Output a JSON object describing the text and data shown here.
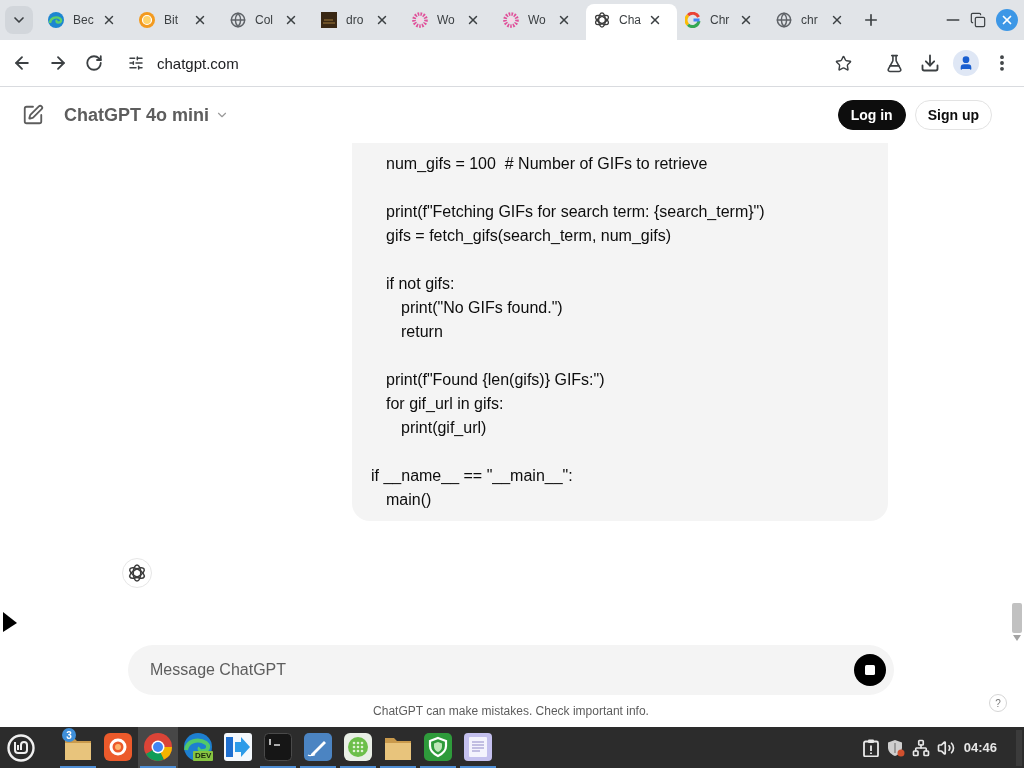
{
  "browser": {
    "tabs": [
      {
        "title": "Bec",
        "kind": "swirl",
        "selected": false
      },
      {
        "title": "Bit",
        "kind": "coin",
        "selected": false
      },
      {
        "title": "Col",
        "kind": "globe",
        "selected": false
      },
      {
        "title": "dro",
        "kind": "thumbnail",
        "selected": false
      },
      {
        "title": "Wo",
        "kind": "flower",
        "selected": false
      },
      {
        "title": "Wo",
        "kind": "flower",
        "selected": false
      },
      {
        "title": "Cha",
        "kind": "knot",
        "selected": true
      },
      {
        "title": "Chr",
        "kind": "g",
        "selected": false
      },
      {
        "title": "chr",
        "kind": "globe",
        "selected": false
      }
    ],
    "url": "chatgpt.com"
  },
  "page": {
    "header": {
      "model": "ChatGPT 4o mini",
      "buttons": [
        {
          "label": "Log in",
          "kind": "filled"
        },
        {
          "label": "Sign up",
          "kind": "outline"
        }
      ]
    },
    "code_blocks": [
      [
        "    num_gifs = 100  # Number of GIFs to retrieve"
      ],
      [
        "    print(f\"Fetching GIFs for search term: {search_term}\")",
        "    gifs = fetch_gifs(search_term, num_gifs)"
      ],
      [
        "    if not gifs:",
        "        print(\"No GIFs found.\")",
        "        return"
      ],
      [
        "    print(f\"Found {len(gifs)} GIFs:\")",
        "    for gif_url in gifs:",
        "        print(gif_url)"
      ],
      [
        "if __name__ == \"__main__\":",
        "    main()"
      ]
    ],
    "composer": {
      "placeholder": "Message ChatGPT"
    },
    "disclaimer": "ChatGPT can make mistakes. Check important info.",
    "help": "?"
  },
  "taskbar": {
    "apps": [
      {
        "kind": "folder",
        "count": "3",
        "running": true,
        "selected": false
      },
      {
        "kind": "fox",
        "running": false,
        "selected": false
      },
      {
        "kind": "chrome",
        "running": true,
        "selected": true
      },
      {
        "kind": "edge",
        "tag": "DEV",
        "running": false,
        "selected": false
      },
      {
        "kind": "arrow",
        "running": false,
        "selected": false
      },
      {
        "kind": "terminal",
        "running": true,
        "selected": false
      },
      {
        "kind": "pen",
        "running": true,
        "selected": false
      },
      {
        "kind": "grid",
        "running": true,
        "selected": false
      },
      {
        "kind": "folder",
        "running": true,
        "selected": false
      },
      {
        "kind": "shield",
        "running": true,
        "selected": false
      },
      {
        "kind": "notes",
        "running": true,
        "selected": false
      }
    ],
    "clock": "04:46"
  }
}
